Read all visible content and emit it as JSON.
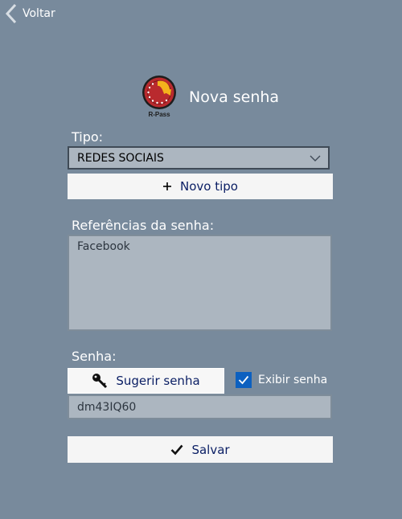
{
  "nav": {
    "back_label": "Voltar"
  },
  "header": {
    "title": "Nova senha",
    "logo_text": "R-Pass"
  },
  "tipo": {
    "label": "Tipo:",
    "selected": "REDES SOCIAIS",
    "new_type_label": "Novo tipo"
  },
  "referencias": {
    "label": "Referências da senha:",
    "value": "Facebook"
  },
  "senha": {
    "label": "Senha:",
    "suggest_label": "Sugerir senha",
    "show_label": "Exibir senha",
    "show_checked": true,
    "value": "dm43IQ60"
  },
  "actions": {
    "save_label": "Salvar"
  },
  "colors": {
    "background": "#788a9c",
    "field_bg": "#acb6c0",
    "button_text": "#0a1e64",
    "checkbox": "#0c60c0",
    "logo_red": "#b92a2e",
    "logo_yellow": "#f4b21c"
  }
}
